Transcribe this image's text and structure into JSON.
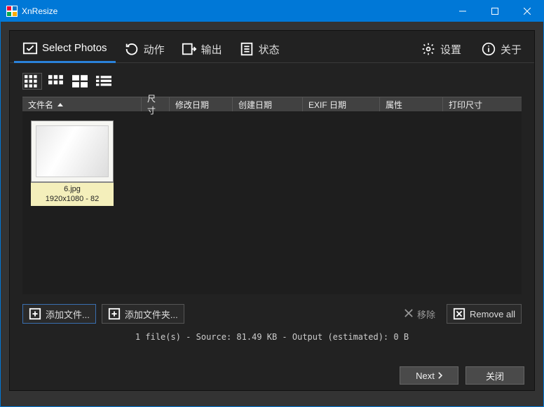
{
  "titlebar": {
    "title": "XnResize"
  },
  "tabs": {
    "select_photos": "Select Photos",
    "actions": "动作",
    "output": "输出",
    "status": "状态",
    "settings": "设置",
    "about": "关于"
  },
  "columns": {
    "filename": "文件名",
    "size": "尺寸",
    "modified": "修改日期",
    "created": "创建日期",
    "exif_date": "EXIF 日期",
    "attributes": "属性",
    "print_size": "打印尺寸"
  },
  "thumbnails": [
    {
      "name": "6.jpg",
      "info": "1920x1080 - 82"
    }
  ],
  "buttons": {
    "add_files": "添加文件...",
    "add_folder": "添加文件夹...",
    "remove": "移除",
    "remove_all": "Remove all",
    "next": "Next",
    "close": "关闭"
  },
  "status": "1 file(s) - Source: 81.49 KB - Output (estimated): 0 B"
}
